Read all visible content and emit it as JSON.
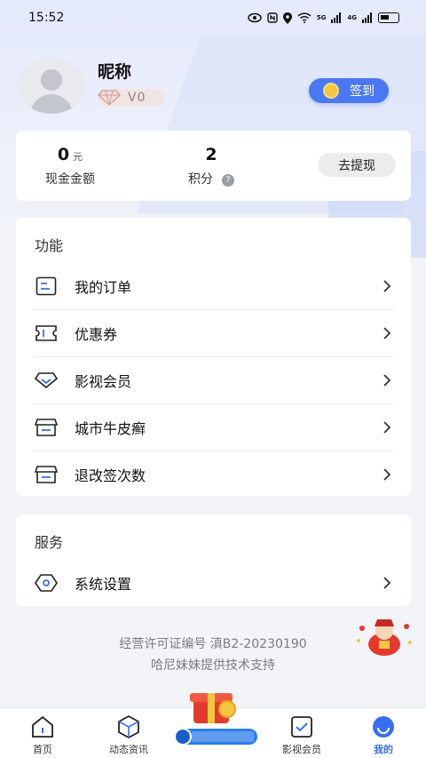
{
  "status_bar": {
    "time": "15:52",
    "network1": "5G",
    "network2": "4G"
  },
  "profile": {
    "nickname": "昵称",
    "vip_level": "V0",
    "checkin_label": "签到"
  },
  "balance": {
    "cash_value": "0",
    "cash_unit": "元",
    "cash_label": "现金金额",
    "points_value": "2",
    "points_label": "积分",
    "help_icon_text": "?",
    "withdraw_label": "去提现"
  },
  "functions": {
    "title": "功能",
    "items": [
      {
        "label": "我的订单",
        "icon": "order-list-icon"
      },
      {
        "label": "优惠券",
        "icon": "coupon-icon"
      },
      {
        "label": "影视会员",
        "icon": "diamond-icon"
      },
      {
        "label": "城市牛皮癣",
        "icon": "store-icon"
      },
      {
        "label": "退改签次数",
        "icon": "store-icon"
      }
    ]
  },
  "services": {
    "title": "服务",
    "items": [
      {
        "label": "系统设置",
        "icon": "hexagon-settings-icon"
      }
    ]
  },
  "footer": {
    "license": "经营许可证编号 滇B2-20230190",
    "support": "哈尼妹妹提供技术支持"
  },
  "nav": {
    "items": [
      {
        "label": "首页",
        "icon": "home-icon"
      },
      {
        "label": "动态资讯",
        "icon": "cube-icon"
      },
      {
        "label": "",
        "icon": "gift-box-icon"
      },
      {
        "label": "影视会员",
        "icon": "checked-box-icon"
      },
      {
        "label": "我的",
        "icon": "profile-smile-icon"
      }
    ],
    "active_index": 4
  },
  "colors": {
    "accent": "#3a6ef0",
    "checkin_bg": "#4a78f0",
    "coin": "#f4c542"
  }
}
